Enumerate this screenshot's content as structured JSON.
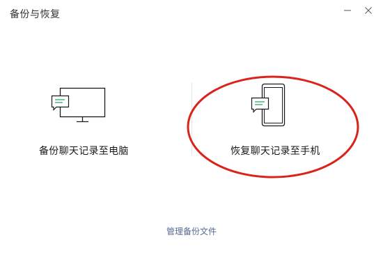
{
  "window": {
    "title": "备份与恢复",
    "minimize_icon": "minimize-icon",
    "close_icon": "close-icon"
  },
  "options": {
    "backup_to_pc": {
      "label": "备份聊天记录至电脑",
      "icon": "monitor-chat-icon"
    },
    "restore_to_phone": {
      "label": "恢复聊天记录至手机",
      "icon": "phone-chat-icon"
    }
  },
  "footer": {
    "manage_label": "管理备份文件"
  },
  "colors": {
    "accent_green": "#2aae67",
    "link_blue": "#576b95",
    "annotation_red": "#d9241b",
    "icon_stroke": "#1a1a1a"
  }
}
